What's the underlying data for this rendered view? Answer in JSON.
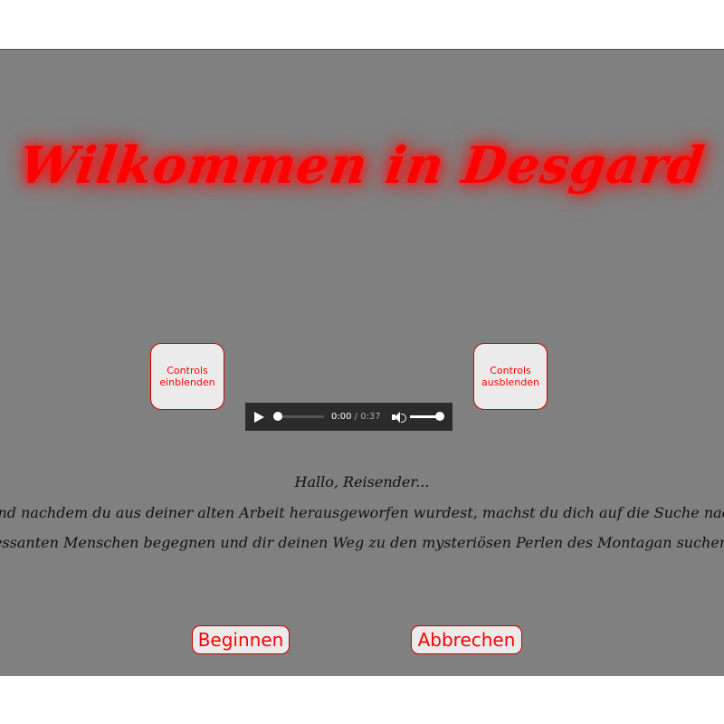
{
  "header": {
    "title": "Wilkommen in Desgard"
  },
  "controls": {
    "show_label": "Controls einblenden",
    "hide_label": "Controls ausblenden"
  },
  "audio": {
    "current_time": "0:00",
    "separator": " / ",
    "duration": "0:37",
    "progress": 0.0,
    "volume": 1.0
  },
  "story": {
    "greeting": "Hallo, Reisender...",
    "line1": "Und nachdem du aus deiner alten Arbeit herausgeworfen wurdest, machst du dich auf die Suche nach einem",
    "line2": "interessanten Menschen begegnen und dir deinen Weg zu den mysteriösen Perlen des Montagan suchen. Viel Glück"
  },
  "actions": {
    "begin_label": "Beginnen",
    "cancel_label": "Abbrechen"
  },
  "colors": {
    "accent": "#ff0000",
    "background": "#808080",
    "button_bg": "#ebebeb",
    "player_bg": "#2b2b2b"
  },
  "icons": {
    "play": "play-icon",
    "volume": "speaker-icon"
  }
}
